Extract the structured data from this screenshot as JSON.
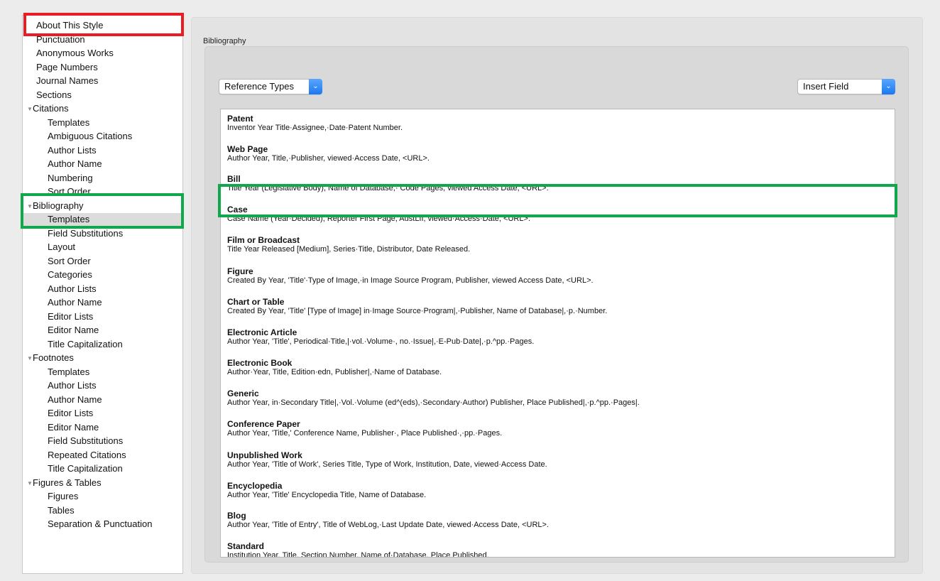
{
  "sidebar": {
    "items": [
      {
        "label": "About This Style",
        "level": 0
      },
      {
        "label": "Punctuation",
        "level": 0
      },
      {
        "label": "Anonymous Works",
        "level": 0
      },
      {
        "label": "Page Numbers",
        "level": 0
      },
      {
        "label": "Journal Names",
        "level": 0
      },
      {
        "label": "Sections",
        "level": 0
      },
      {
        "label": "Citations",
        "level": 0,
        "expanded": true
      },
      {
        "label": "Templates",
        "level": 1
      },
      {
        "label": "Ambiguous Citations",
        "level": 1
      },
      {
        "label": "Author Lists",
        "level": 1
      },
      {
        "label": "Author Name",
        "level": 1
      },
      {
        "label": "Numbering",
        "level": 1
      },
      {
        "label": "Sort Order",
        "level": 1
      },
      {
        "label": "Bibliography",
        "level": 0,
        "expanded": true
      },
      {
        "label": "Templates",
        "level": 1,
        "selected": true
      },
      {
        "label": "Field Substitutions",
        "level": 1
      },
      {
        "label": "Layout",
        "level": 1
      },
      {
        "label": "Sort Order",
        "level": 1
      },
      {
        "label": "Categories",
        "level": 1
      },
      {
        "label": "Author Lists",
        "level": 1
      },
      {
        "label": "Author Name",
        "level": 1
      },
      {
        "label": "Editor Lists",
        "level": 1
      },
      {
        "label": "Editor Name",
        "level": 1
      },
      {
        "label": "Title Capitalization",
        "level": 1
      },
      {
        "label": "Footnotes",
        "level": 0,
        "expanded": true
      },
      {
        "label": "Templates",
        "level": 1
      },
      {
        "label": "Author Lists",
        "level": 1
      },
      {
        "label": "Author Name",
        "level": 1
      },
      {
        "label": "Editor Lists",
        "level": 1
      },
      {
        "label": "Editor Name",
        "level": 1
      },
      {
        "label": "Field Substitutions",
        "level": 1
      },
      {
        "label": "Repeated Citations",
        "level": 1
      },
      {
        "label": "Title Capitalization",
        "level": 1
      },
      {
        "label": "Figures & Tables",
        "level": 0,
        "expanded": true
      },
      {
        "label": "Figures",
        "level": 1
      },
      {
        "label": "Tables",
        "level": 1
      },
      {
        "label": "Separation & Punctuation",
        "level": 1
      }
    ]
  },
  "main": {
    "section_title": "Bibliography",
    "reference_types_label": "Reference Types",
    "insert_field_label": "Insert Field",
    "templates": [
      {
        "name": "Patent",
        "format": "Inventor Year Title·Assignee,·Date·Patent Number."
      },
      {
        "name": "Web Page",
        "format": "Author Year, Title,·Publisher, viewed·Access Date, <URL>."
      },
      {
        "name": "Bill",
        "format": "Title Year (Legislative Body), Name of Database,· Code Pages, viewed Access Date, <URL>."
      },
      {
        "name": "Case",
        "format": "Case Name (Year·Decided), Reporter First Page, AustLII, viewed·Access·Date, <URL>."
      },
      {
        "name": "Film or Broadcast",
        "format": "Title Year Released [Medium], Series·Title, Distributor, Date Released."
      },
      {
        "name": "Figure",
        "format": "Created By Year, 'Title'·Type of Image,·in Image Source Program, Publisher, viewed Access Date, <URL>."
      },
      {
        "name": "Chart or Table",
        "format": "Created By Year, 'Title' [Type of Image] in·Image Source·Program|,·Publisher, Name of Database|,·p.·Number."
      },
      {
        "name": "Electronic Article",
        "format": "Author Year, 'Title', Periodical·Title,|·vol.·Volume·, no.·Issue|,·E-Pub·Date|,·p.^pp.·Pages."
      },
      {
        "name": "Electronic Book",
        "format": "Author·Year, Title, Edition·edn, Publisher|,·Name of Database."
      },
      {
        "name": "Generic",
        "format": "Author Year, in·Secondary Title|,·Vol.·Volume (ed^(eds),·Secondary·Author) Publisher, Place Published|,·p.^pp.·Pages|."
      },
      {
        "name": "Conference Paper",
        "format": "Author Year, 'Title,' Conference Name, Publisher·, Place Published·,·pp.·Pages."
      },
      {
        "name": "Unpublished Work",
        "format": "Author Year, 'Title of Work', Series Title, Type of Work, Institution, Date, viewed·Access Date."
      },
      {
        "name": "Encyclopedia",
        "format": "Author Year, 'Title' Encyclopedia Title, Name of Database."
      },
      {
        "name": "Blog",
        "format": "Author Year, 'Title of Entry', Title of WebLog,·Last Update Date, viewed·Access Date, <URL>."
      },
      {
        "name": "Standard",
        "format": "Institution Year, Title, Section Number, Name of·Database, Place Published."
      }
    ]
  },
  "colors": {
    "highlight_red": "#ea1c24",
    "highlight_green": "#11a84c",
    "popup_accent": "#1c78f0"
  }
}
